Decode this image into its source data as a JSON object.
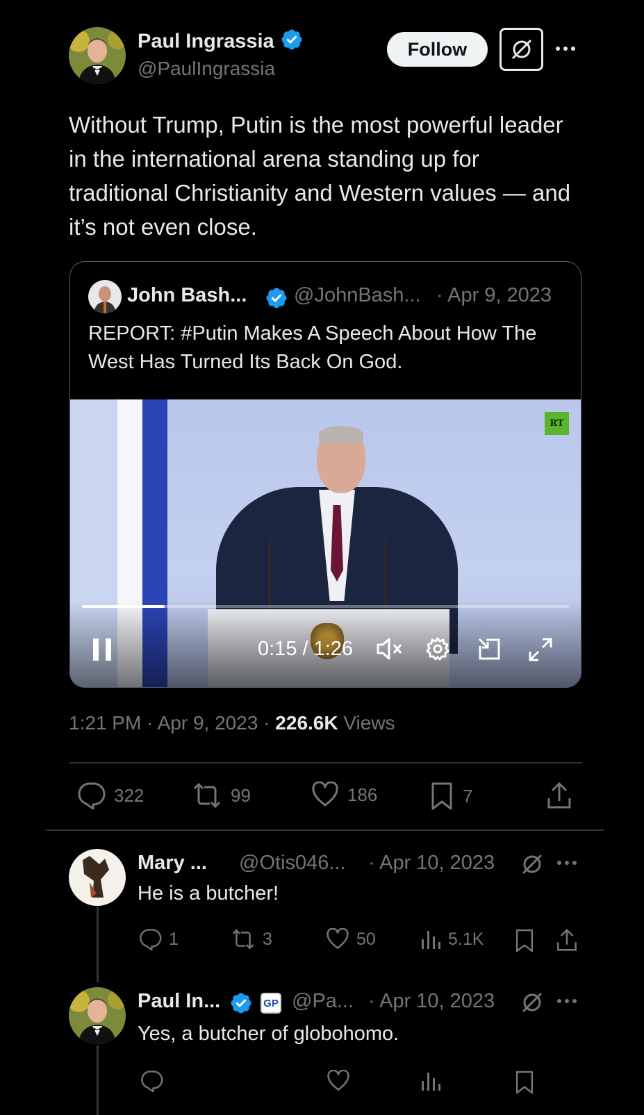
{
  "author": {
    "name": "Paul Ingrassia",
    "handle": "@PaulIngrassia",
    "verified_icon": "verified-badge-icon",
    "follow_label": "Follow"
  },
  "tweet": {
    "text": "Without Trump, Putin is the most powerful leader in the international arena standing up for traditional Christianity and Western values — and it’s not even close.",
    "time": "1:21 PM",
    "date": "Apr 9, 2023",
    "views_count": "226.6K",
    "views_label": "Views",
    "sep": "·"
  },
  "quote": {
    "name": "John Bash...",
    "handle": "@JohnBash...",
    "date": "· Apr 9, 2023",
    "text": "REPORT: #Putin Makes A Speech About How The West Has Turned Its Back On God.",
    "video": {
      "logo": "RT",
      "time": "0:15 / 1:26",
      "progress": 0.17
    }
  },
  "actions": {
    "replies": "322",
    "reposts": "99",
    "likes": "186",
    "bookmarks": "7"
  },
  "replies": [
    {
      "name": "Mary ...",
      "handle": "@Otis046...",
      "date": "· Apr 10, 2023",
      "text": "He is a butcher!",
      "replies": "1",
      "reposts": "3",
      "likes": "50",
      "views": "5.1K"
    },
    {
      "name": "Paul In...",
      "badge": "GP",
      "handle": "@Pa...",
      "date": "· Apr 10, 2023",
      "text": "Yes, a butcher of globohomo."
    }
  ],
  "colors": {
    "background": "#000000",
    "verified": "#1d9bf0",
    "muted": "#71767b",
    "divider": "#2f3336"
  }
}
